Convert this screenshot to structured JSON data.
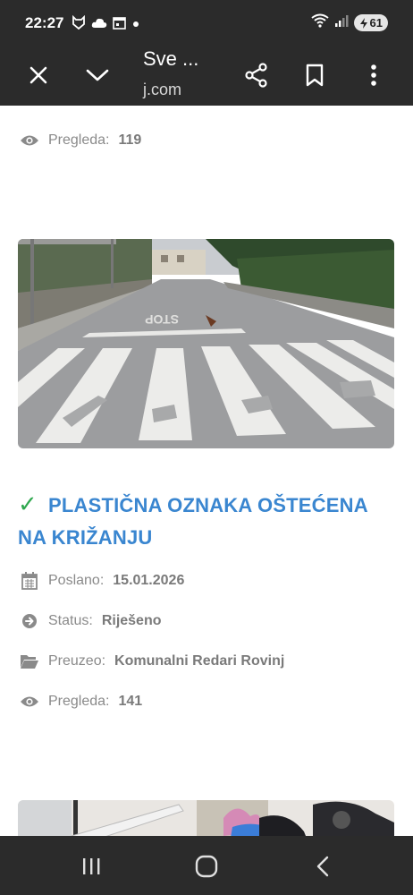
{
  "status_bar": {
    "time": "22:27",
    "battery": "61",
    "icons": [
      "guard-icon",
      "cloud-icon",
      "calendar-icon",
      "dot-icon",
      "wifi-icon",
      "signal-icon",
      "battery-icon"
    ]
  },
  "toolbar": {
    "title": "Sve ...",
    "url": "j.com",
    "icons": [
      "close-icon",
      "chevron-down-icon",
      "share-icon",
      "bookmark-icon",
      "more-icon"
    ]
  },
  "previous_post": {
    "views_label": "Pregleda:",
    "views_value": "119"
  },
  "post": {
    "title": "PLASTIČNA OZNAKA OŠTEĆENA NA KRIŽANJU",
    "status_mark": "✓",
    "meta": {
      "sent_label": "Poslano:",
      "sent_value": "15.01.2026",
      "status_label": "Status:",
      "status_value": "Riješeno",
      "taken_label": "Preuzeo:",
      "taken_value": "Komunalni Redari Rovinj",
      "views_label": "Pregleda:",
      "views_value": "141"
    },
    "image_road_text": "STOP"
  },
  "colors": {
    "title_blue": "#3a86d0",
    "check_green": "#2fa84f",
    "meta_gray": "#8a8a8a",
    "chrome_dark": "#2b2b2b"
  }
}
